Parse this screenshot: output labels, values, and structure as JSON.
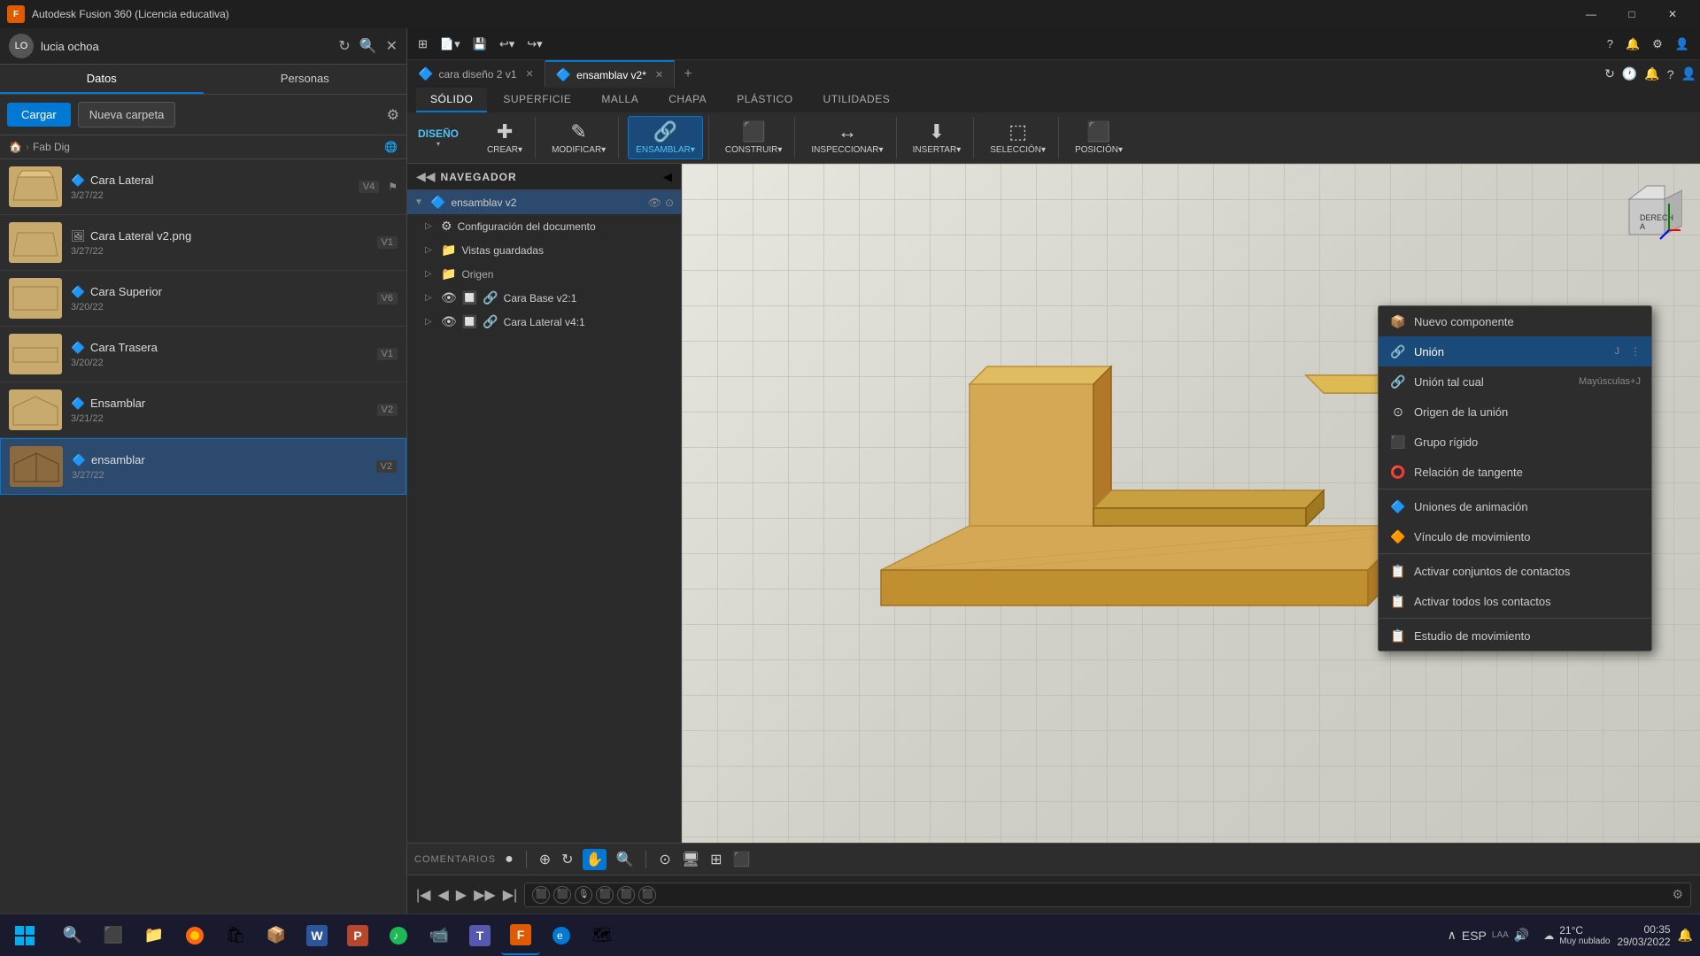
{
  "app": {
    "title": "Autodesk Fusion 360 (Licencia educativa)",
    "icon": "F"
  },
  "window_controls": {
    "minimize": "—",
    "maximize": "□",
    "close": "✕"
  },
  "sidebar": {
    "user": "lucia ochoa",
    "tabs": [
      "Datos",
      "Personas"
    ],
    "actions": {
      "cargar": "Cargar",
      "nueva_carpeta": "Nueva carpeta"
    },
    "breadcrumb": [
      "🏠",
      "Fab Dig"
    ],
    "files": [
      {
        "name": "Cara Lateral",
        "date": "3/27/22",
        "version": "V4",
        "type": "3d"
      },
      {
        "name": "Cara Lateral v2.png",
        "date": "3/27/22",
        "version": "V1",
        "type": "img"
      },
      {
        "name": "Cara Superior",
        "date": "3/20/22",
        "version": "V6",
        "type": "3d"
      },
      {
        "name": "Cara Trasera",
        "date": "3/20/22",
        "version": "V1",
        "type": "3d"
      },
      {
        "name": "Ensamblar",
        "date": "3/21/22",
        "version": "V2",
        "type": "3d"
      },
      {
        "name": "ensamblar",
        "date": "3/27/22",
        "version": "V2",
        "type": "3d",
        "active": true
      }
    ]
  },
  "ribbon": {
    "tabs": [
      "SÓLIDO",
      "SUPERFICIE",
      "MALLA",
      "CHAPA",
      "PLÁSTICO",
      "UTILIDADES"
    ],
    "active_tab": "SÓLIDO",
    "dropdown": "DISEÑO",
    "groups": [
      {
        "label": "CREAR",
        "arrow": "▾"
      },
      {
        "label": "MODIFICAR",
        "arrow": "▾"
      },
      {
        "label": "ENSAMBLAR",
        "arrow": "▾",
        "active": true
      },
      {
        "label": "CONSTRUIR",
        "arrow": "▾"
      },
      {
        "label": "INSPECCIONAR",
        "arrow": "▾"
      },
      {
        "label": "INSERTAR",
        "arrow": "▾"
      },
      {
        "label": "SELECCIÓN",
        "arrow": "▾"
      },
      {
        "label": "POSICIÓN",
        "arrow": "▾"
      }
    ],
    "top_tabs": [
      {
        "label": "cara diseño 2 v1",
        "active": false,
        "icon": "🔷"
      },
      {
        "label": "ensamblav v2*",
        "active": true,
        "icon": "🔷"
      }
    ]
  },
  "navigator": {
    "title": "NAVEGADOR",
    "root": "ensamblav v2",
    "items": [
      {
        "label": "Configuración del documento",
        "icon": "⚙",
        "depth": 1
      },
      {
        "label": "Vistas guardadas",
        "icon": "📁",
        "depth": 1
      },
      {
        "label": "Origen",
        "icon": "📁",
        "depth": 1
      },
      {
        "label": "Cara Base v2:1",
        "icon": "📦",
        "depth": 1
      },
      {
        "label": "Cara Lateral v4:1",
        "icon": "📦",
        "depth": 1
      }
    ]
  },
  "dropdown_menu": {
    "items": [
      {
        "label": "Nuevo componente",
        "icon": "📦",
        "shortcut": "",
        "highlighted": false
      },
      {
        "label": "Unión",
        "icon": "🔗",
        "shortcut": "J",
        "highlighted": true
      },
      {
        "label": "Unión tal cual",
        "icon": "🔗",
        "shortcut": "Mayúsculas+J",
        "highlighted": false
      },
      {
        "label": "Origen de la unión",
        "icon": "⊙",
        "shortcut": "",
        "highlighted": false
      },
      {
        "label": "Grupo rígido",
        "icon": "⬛",
        "shortcut": "",
        "highlighted": false
      },
      {
        "label": "Relación de tangente",
        "icon": "⭕",
        "shortcut": "",
        "highlighted": false
      },
      {
        "label": "Uniones de animación",
        "icon": "🔷",
        "shortcut": "",
        "highlighted": false
      },
      {
        "label": "Vínculo de movimiento",
        "icon": "🔶",
        "shortcut": "",
        "highlighted": false
      },
      {
        "label": "Activar conjuntos de contactos",
        "icon": "📋",
        "shortcut": "",
        "highlighted": false
      },
      {
        "label": "Activar todos los contactos",
        "icon": "📋",
        "shortcut": "",
        "highlighted": false
      },
      {
        "label": "Estudio de movimiento",
        "icon": "📋",
        "shortcut": "",
        "highlighted": false
      }
    ]
  },
  "bottom_bar": {
    "label": "COMENTARIOS",
    "icons": [
      "●",
      "⊕",
      "🔄",
      "✋",
      "🔍",
      "⊙",
      "⬛",
      "⬛"
    ]
  },
  "timeline": {
    "controls": [
      "|◀",
      "◀",
      "▶",
      "▶▶",
      "▶|"
    ],
    "icons": [
      "⬛",
      "⬛",
      "🎙",
      "⬛",
      "⬛",
      "⬛"
    ]
  },
  "taskbar": {
    "apps": [
      {
        "icon": "⊞",
        "name": "start"
      },
      {
        "icon": "🔍",
        "name": "search"
      },
      {
        "icon": "🪟",
        "name": "task-view"
      },
      {
        "icon": "📁",
        "name": "explorer"
      },
      {
        "icon": "🔥",
        "name": "firefox"
      },
      {
        "icon": "📦",
        "name": "store"
      },
      {
        "icon": "⬛",
        "name": "app1"
      },
      {
        "icon": "W",
        "name": "word"
      },
      {
        "icon": "P",
        "name": "powerpoint"
      },
      {
        "icon": "🎵",
        "name": "spotify"
      },
      {
        "icon": "📹",
        "name": "zoom"
      },
      {
        "icon": "T",
        "name": "teams"
      },
      {
        "icon": "F",
        "name": "fusion"
      },
      {
        "icon": "🌐",
        "name": "edge"
      },
      {
        "icon": "🗺",
        "name": "maps"
      }
    ],
    "weather": {
      "temp": "21°C",
      "condition": "Muy nublado"
    },
    "systray": {
      "lang": "ESP",
      "region": "LAA"
    },
    "time": "00:35",
    "date": "29/03/2022"
  }
}
